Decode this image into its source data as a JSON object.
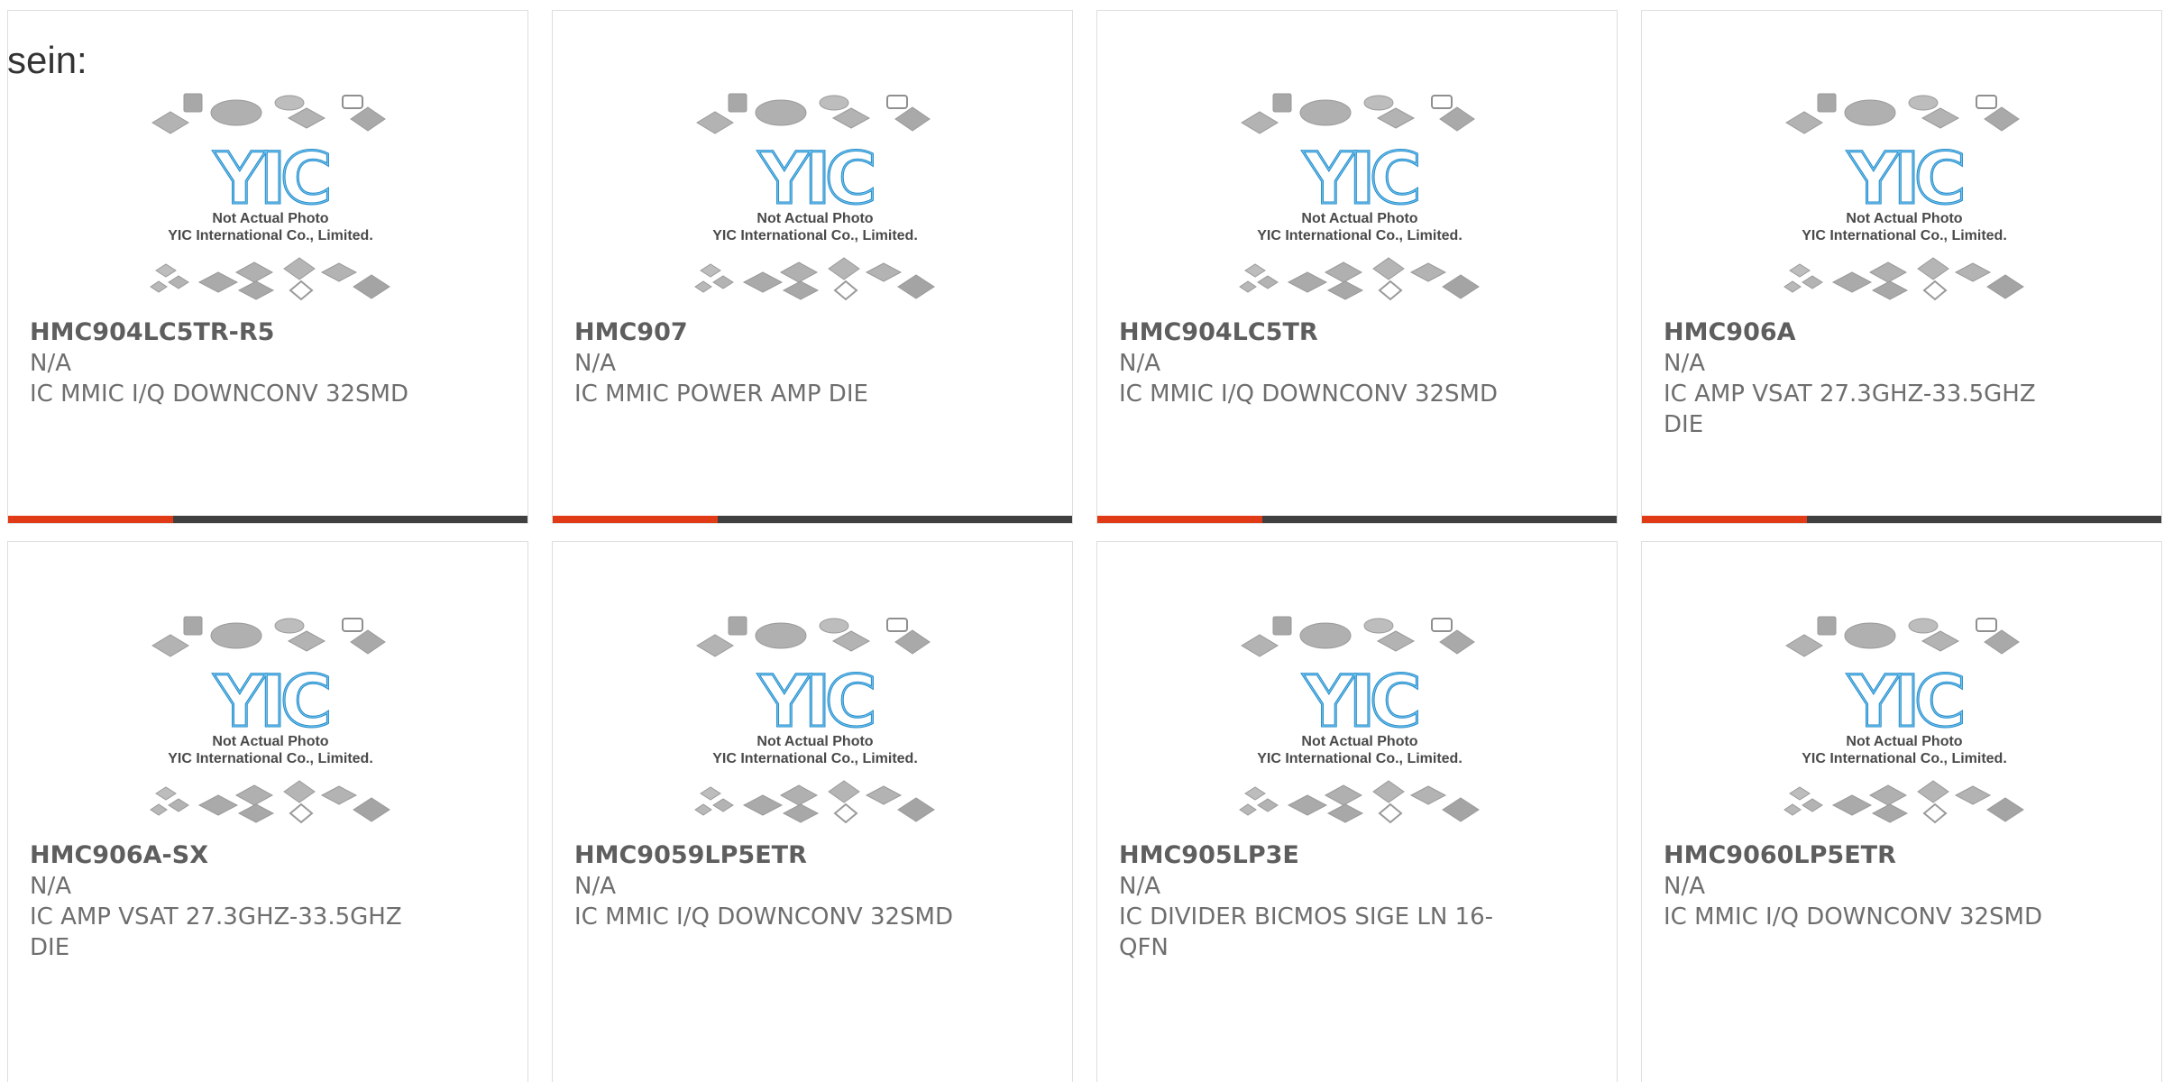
{
  "intro_text": "sein:",
  "image_caption": {
    "logo": "YIC",
    "line1": "Not Actual Photo",
    "line2": "YIC International Co., Limited."
  },
  "colors": {
    "accent_red": "#e03a16",
    "accent_dark": "#404040",
    "logo_blue": "#1f86c6",
    "logo_light": "#6fc3ee",
    "card_border": "#dedede"
  },
  "icons": {
    "product_image": "chip-packages-placeholder-icon",
    "logo": "yic-logo-icon"
  },
  "products": [
    {
      "part_number": "HMC904LC5TR-R5",
      "manufacturer": "N/A",
      "description": "IC MMIC I/Q DOWNCONV 32SMD"
    },
    {
      "part_number": "HMC907",
      "manufacturer": "N/A",
      "description": "IC MMIC POWER AMP DIE"
    },
    {
      "part_number": "HMC904LC5TR",
      "manufacturer": "N/A",
      "description": "IC MMIC I/Q DOWNCONV 32SMD"
    },
    {
      "part_number": "HMC906A",
      "manufacturer": "N/A",
      "description": "IC AMP VSAT 27.3GHZ-33.5GHZ DIE"
    },
    {
      "part_number": "HMC906A-SX",
      "manufacturer": "N/A",
      "description": "IC AMP VSAT 27.3GHZ-33.5GHZ DIE"
    },
    {
      "part_number": "HMC9059LP5ETR",
      "manufacturer": "N/A",
      "description": "IC MMIC I/Q DOWNCONV 32SMD"
    },
    {
      "part_number": "HMC905LP3E",
      "manufacturer": "N/A",
      "description": "IC DIVIDER BICMOS SIGE LN 16-QFN"
    },
    {
      "part_number": "HMC9060LP5ETR",
      "manufacturer": "N/A",
      "description": "IC MMIC I/Q DOWNCONV 32SMD"
    }
  ]
}
